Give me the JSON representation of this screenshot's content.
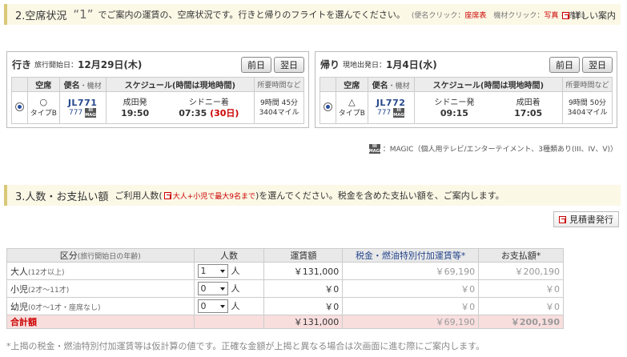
{
  "section2": {
    "title": "2.空席状況",
    "quote": "“1”",
    "desc": "でご案内の運賃の、空席状況です。行きと帰りのフライトを選んでください。",
    "hint_open": "(便名クリック：",
    "hint_seat": "座席表",
    "hint_mid": "　機材クリック：",
    "hint_photo": "写真",
    "hint_close": " を表示)",
    "detail_link": "詳しい案内"
  },
  "outbound": {
    "direction": "行き",
    "date_label": "旅行開始日：",
    "date_value": "12月29日(木)",
    "prev_btn": "前日",
    "next_btn": "翌日",
    "headers": {
      "seat": "空席",
      "flight": "便名",
      "flight_sub": "・機材",
      "schedule": "スケジュール(時間は現地時間)",
      "duration": "所要時間など"
    },
    "row": {
      "seat_mark": "○",
      "seat_type": "タイプB",
      "flight_no": "JL771",
      "aircraft": "777",
      "dep_station": "成田発",
      "dep_time": "19:50",
      "arr_station": "シドニー着",
      "arr_time": "07:35",
      "arr_day": "(30日)",
      "duration": "9時間 45分",
      "miles": "3404マイル"
    }
  },
  "inbound": {
    "direction": "帰り",
    "date_label": "現地出発日：",
    "date_value": "1月4日(水)",
    "prev_btn": "前日",
    "next_btn": "翌日",
    "headers": {
      "seat": "空席",
      "flight": "便名",
      "flight_sub": "・機材",
      "schedule": "スケジュール(時間は現地時間)",
      "duration": "所要時間など"
    },
    "row": {
      "seat_mark": "△",
      "seat_type": "タイプB",
      "flight_no": "JL772",
      "aircraft": "777",
      "dep_station": "シドニー発",
      "dep_time": "09:15",
      "arr_station": "成田着",
      "arr_time": "17:05",
      "duration": "9時間 50分",
      "miles": "3404マイル"
    }
  },
  "magic_note": "：MAGIC（個人用テレビ/エンターテイメント、3種類あり(III、IV、V)）",
  "section3": {
    "title": "3.人数・お支払い額",
    "desc_pre": "ご利用人数(",
    "desc_link": "大人+小児で最大9名まで",
    "desc_post": ")を選んでください。税金を含めた支払い額を、ご案内します。",
    "estimate_btn": "見積書発行"
  },
  "payment": {
    "headers": {
      "category": "区分",
      "category_sub": "(旅行開始日の年齢)",
      "count": "人数",
      "fare": "運賃額",
      "surcharge": "税金・燃油特別付加運賃等*",
      "total": "お支払額*"
    },
    "rows": [
      {
        "label": "大人",
        "sub": "(12才以上)",
        "count": "1",
        "unit": "人",
        "fare": "￥131,000",
        "surcharge": "￥69,190",
        "total": "￥200,190"
      },
      {
        "label": "小児",
        "sub": "(2才～11才)",
        "count": "0",
        "unit": "人",
        "fare": "￥0",
        "surcharge": "￥0",
        "total": "￥0"
      },
      {
        "label": "幼児",
        "sub": "(0才～1才・座席なし)",
        "count": "0",
        "unit": "人",
        "fare": "￥0",
        "surcharge": "￥0",
        "total": "￥0"
      }
    ],
    "total_row": {
      "label": "合計額",
      "fare": "￥131,000",
      "surcharge": "￥69,190",
      "total": "￥200,190"
    }
  },
  "footnote": "*上揭の税金・燃油特別付加運賃等は仮計算の値です。正確な金額が上揭と異なる場合は次画面に進む際にご案内します。"
}
